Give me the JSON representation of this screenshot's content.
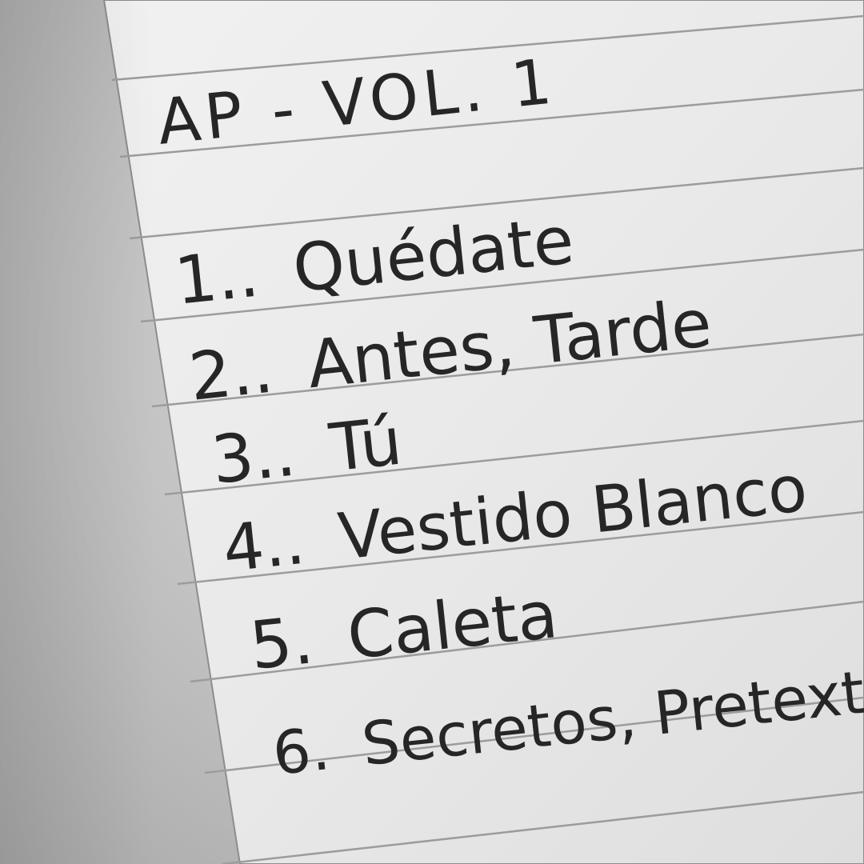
{
  "notebook": {
    "title": "AP - VOL. 1",
    "tracks": [
      {
        "number": "1..",
        "name": "Quédate"
      },
      {
        "number": "2..",
        "name": "Antes, Tarde"
      },
      {
        "number": "3..",
        "name": "Tú"
      },
      {
        "number": "4..",
        "name": "Vestido Blanco"
      },
      {
        "number": "5.",
        "name": "Caleta"
      },
      {
        "number": "6.",
        "name": "Secretos, Pretextos"
      }
    ]
  },
  "colors": {
    "paper": "#eeeeee",
    "ink": "#262626",
    "rule_line": "#9c9c9c"
  }
}
